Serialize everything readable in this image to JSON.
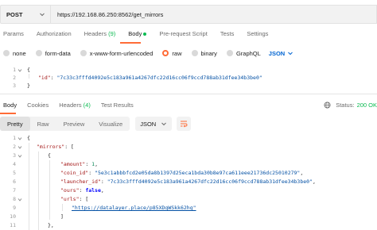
{
  "request": {
    "method": "POST",
    "url": "https://192.168.86.250:8562/get_mirrors"
  },
  "request_tabs": [
    {
      "label": "Params",
      "count": ""
    },
    {
      "label": "Authorization",
      "count": ""
    },
    {
      "label": "Headers",
      "count": "(9)"
    },
    {
      "label": "Body",
      "count": ""
    },
    {
      "label": "Pre-request Script",
      "count": ""
    },
    {
      "label": "Tests",
      "count": ""
    },
    {
      "label": "Settings",
      "count": ""
    }
  ],
  "body_types": [
    "none",
    "form-data",
    "x-www-form-urlencoded",
    "raw",
    "binary",
    "GraphQL"
  ],
  "body_format": "JSON",
  "request_body": {
    "lines": [
      "1",
      "2",
      "3"
    ],
    "open": "{",
    "key": "\"id\"",
    "colon": ": ",
    "value": "\"7c33c3fffd4092e5c183a961a4267dfc22d16cc06f9ccd788ab31dfee34b3be0\"",
    "close": "}"
  },
  "response_tabs": [
    {
      "label": "Body",
      "count": ""
    },
    {
      "label": "Cookies",
      "count": ""
    },
    {
      "label": "Headers",
      "count": "(4)"
    },
    {
      "label": "Test Results",
      "count": ""
    }
  ],
  "status": {
    "label": "Status:",
    "value": "200 OK"
  },
  "view_modes": [
    "Pretty",
    "Raw",
    "Preview",
    "Visualize"
  ],
  "response_format": "JSON",
  "response_body": {
    "line_numbers": [
      "1",
      "2",
      "3",
      "4",
      "5",
      "6",
      "7",
      "8",
      "9",
      "10",
      "11"
    ],
    "l1": "{",
    "l2_key": "\"mirrors\"",
    "l2_rest": ": [",
    "l3": "{",
    "l4_key": "\"amount\"",
    "l4_val": "1",
    "l5_key": "\"coin_id\"",
    "l5_val": "\"5e3c1abbbfcd2e05da8b1397d25eca1bda30b8e97ca611eee21736dc25010279\"",
    "l6_key": "\"launcher_id\"",
    "l6_val": "\"7c33c3fffd4092e5c183a961a4267dfc22d16cc06f9ccd788ab31dfee34b3be0\"",
    "l7_key": "\"ours\"",
    "l7_val": "false",
    "l8_key": "\"urls\"",
    "l8_rest": ": [",
    "l9_val": "\"https://datalayer.place/p85XDqWSkk62hg\"",
    "l10": "]",
    "l11": "},"
  }
}
